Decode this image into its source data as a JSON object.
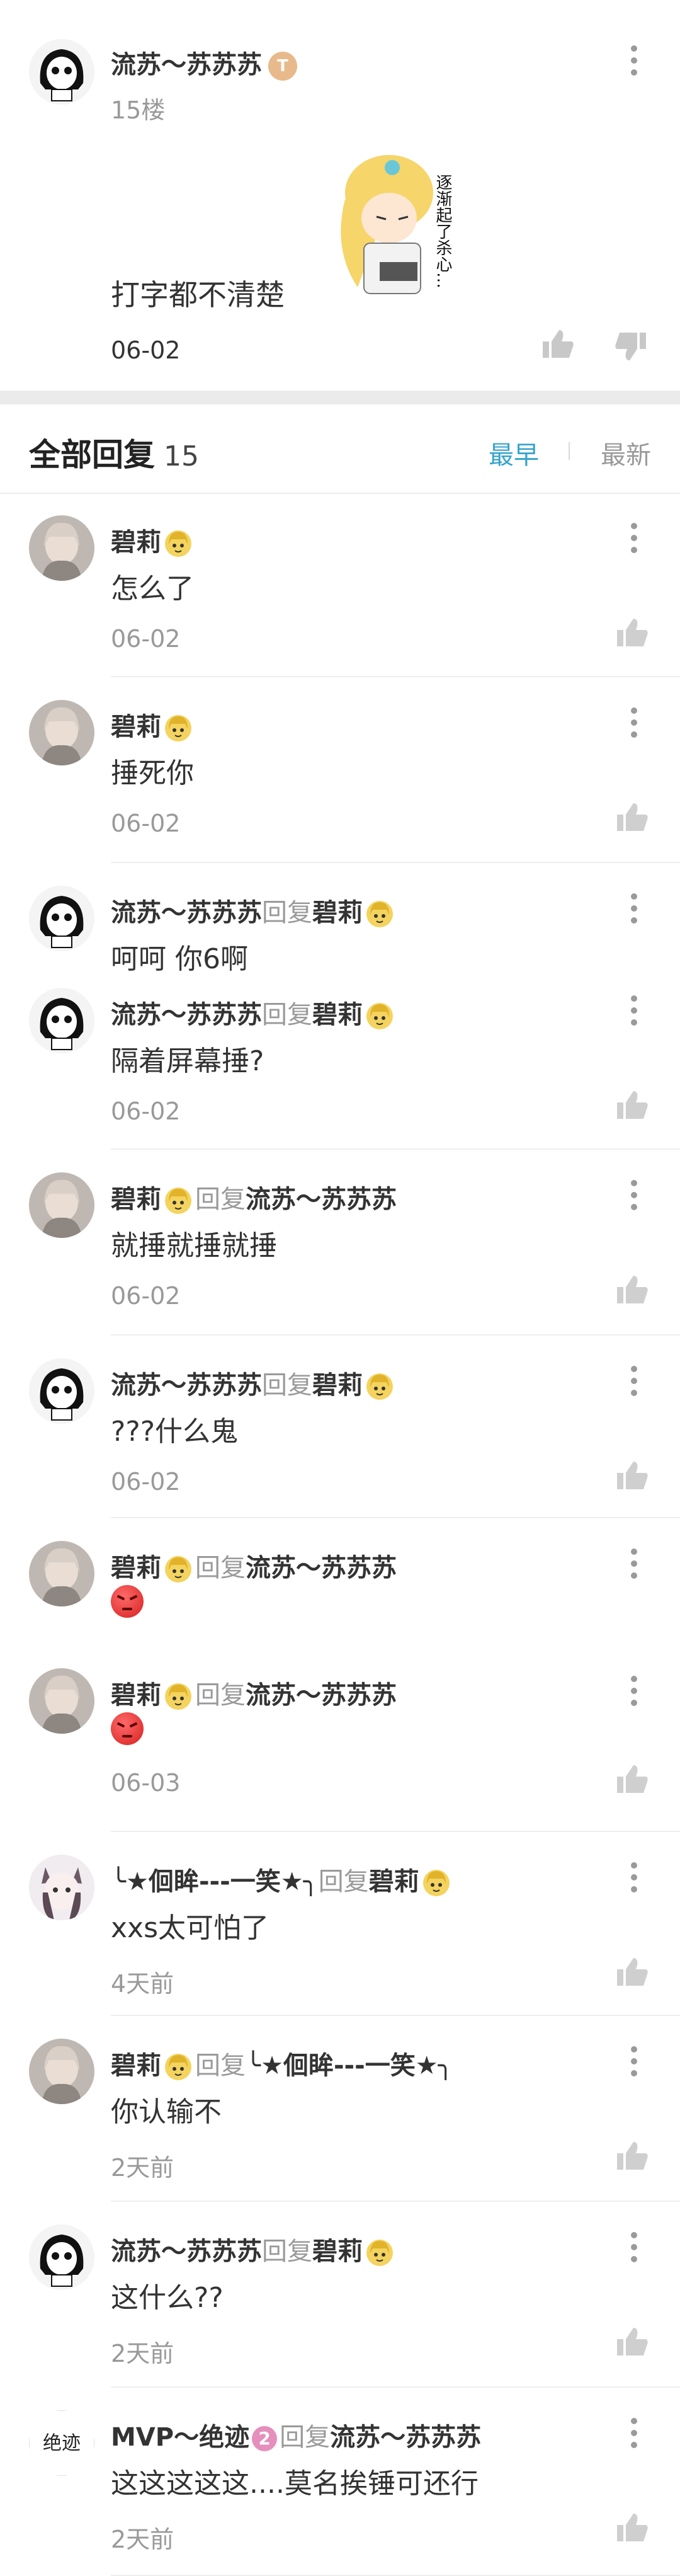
{
  "post": {
    "username": "流苏～苏苏苏",
    "level_badge": "T",
    "floor": "15楼",
    "text": "打字都不清楚",
    "sticker_caption": "逐渐起了杀心…",
    "date": "06-02"
  },
  "replies_header": {
    "title": "全部回复",
    "count": "15",
    "sort_earliest": "最早",
    "sort_latest": "最新"
  },
  "reply_word": "回复",
  "replies": [
    {
      "user": "碧莉",
      "target": "",
      "text": "怎么了",
      "date": "06-02"
    },
    {
      "user": "碧莉",
      "target": "",
      "text": "捶死你",
      "date": "06-02"
    },
    {
      "user": "流苏～苏苏苏",
      "target": "碧莉",
      "text": "呵呵 你6啊",
      "date": ""
    },
    {
      "user": "流苏～苏苏苏",
      "target": "碧莉",
      "text": "隔着屏幕捶?",
      "date": "06-02"
    },
    {
      "user": "碧莉",
      "target": "流苏～苏苏苏",
      "text": "就捶就捶就捶",
      "date": "06-02"
    },
    {
      "user": "流苏～苏苏苏",
      "target": "碧莉",
      "text": "???什么鬼",
      "date": "06-02"
    },
    {
      "user": "碧莉",
      "target": "流苏～苏苏苏",
      "text": "",
      "date": ""
    },
    {
      "user": "碧莉",
      "target": "流苏～苏苏苏",
      "text": "",
      "date": "06-03"
    },
    {
      "user": "╰★佪眸---一笑★╮",
      "target": "碧莉",
      "text": "xxs太可怕了",
      "date": "4天前"
    },
    {
      "user": "碧莉",
      "target": "╰★佪眸---一笑★╮",
      "text": "你认输不",
      "date": "2天前"
    },
    {
      "user": "流苏～苏苏苏",
      "target": "碧莉",
      "text": "这什么??",
      "date": "2天前"
    },
    {
      "user": "MVP～绝迹",
      "user_badge": "2",
      "target": "流苏～苏苏苏",
      "text": "这这这这这....莫名挨锤可还行",
      "date": "2天前"
    }
  ],
  "avatar_logo_text": "绝迹"
}
